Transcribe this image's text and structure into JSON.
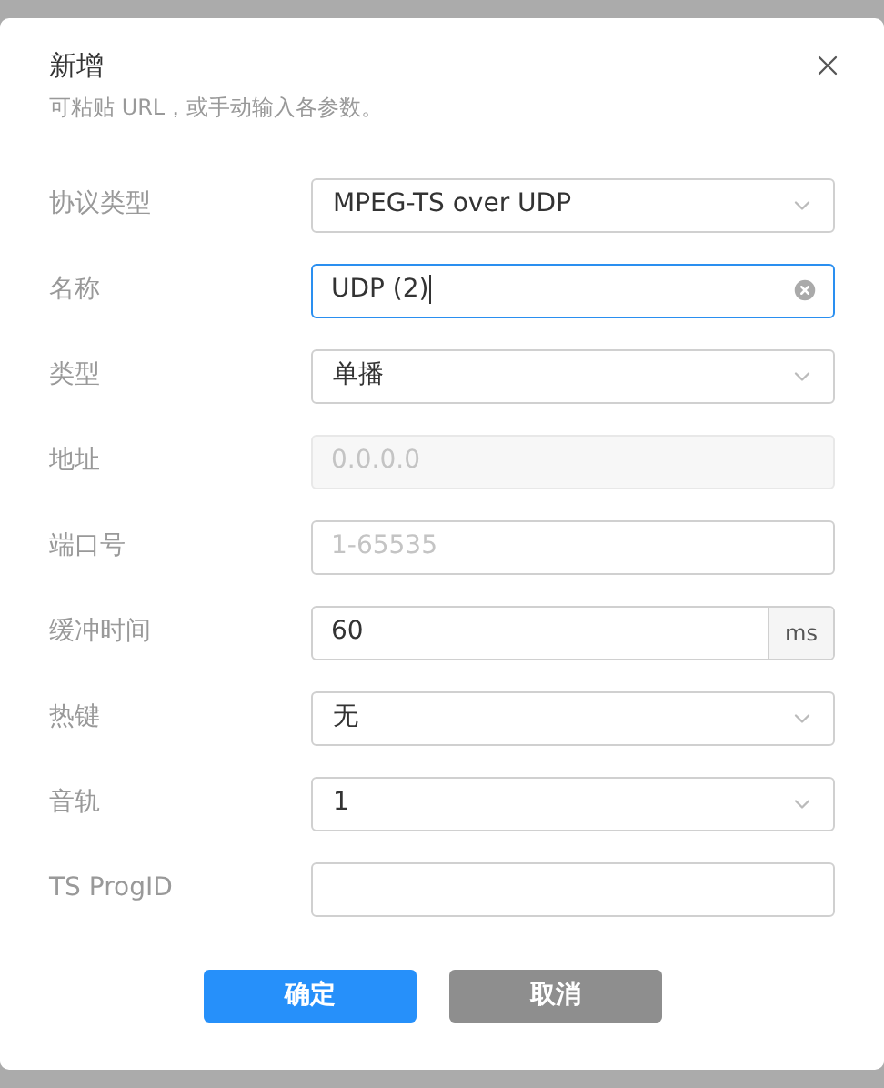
{
  "dialog": {
    "title": "新增",
    "subtitle": "可粘贴 URL，或手动输入各参数。",
    "fields": [
      {
        "kind": "select",
        "label": "协议类型",
        "value": "MPEG-TS over UDP"
      },
      {
        "kind": "text",
        "label": "名称",
        "value": "UDP (2)",
        "focused": true
      },
      {
        "kind": "select",
        "label": "类型",
        "value": "单播"
      },
      {
        "kind": "text",
        "label": "地址",
        "placeholder": "0.0.0.0",
        "disabled": true
      },
      {
        "kind": "text",
        "label": "端口号",
        "placeholder": "1-65535"
      },
      {
        "kind": "addon",
        "label": "缓冲时间",
        "value": "60",
        "unit": "ms"
      },
      {
        "kind": "select",
        "label": "热键",
        "value": "无"
      },
      {
        "kind": "select",
        "label": "音轨",
        "value": "1"
      },
      {
        "kind": "text",
        "label": "TS ProgID"
      }
    ],
    "buttons": [
      {
        "label": "确定",
        "kind": "primary"
      },
      {
        "label": "取消",
        "kind": "secondary"
      }
    ]
  }
}
